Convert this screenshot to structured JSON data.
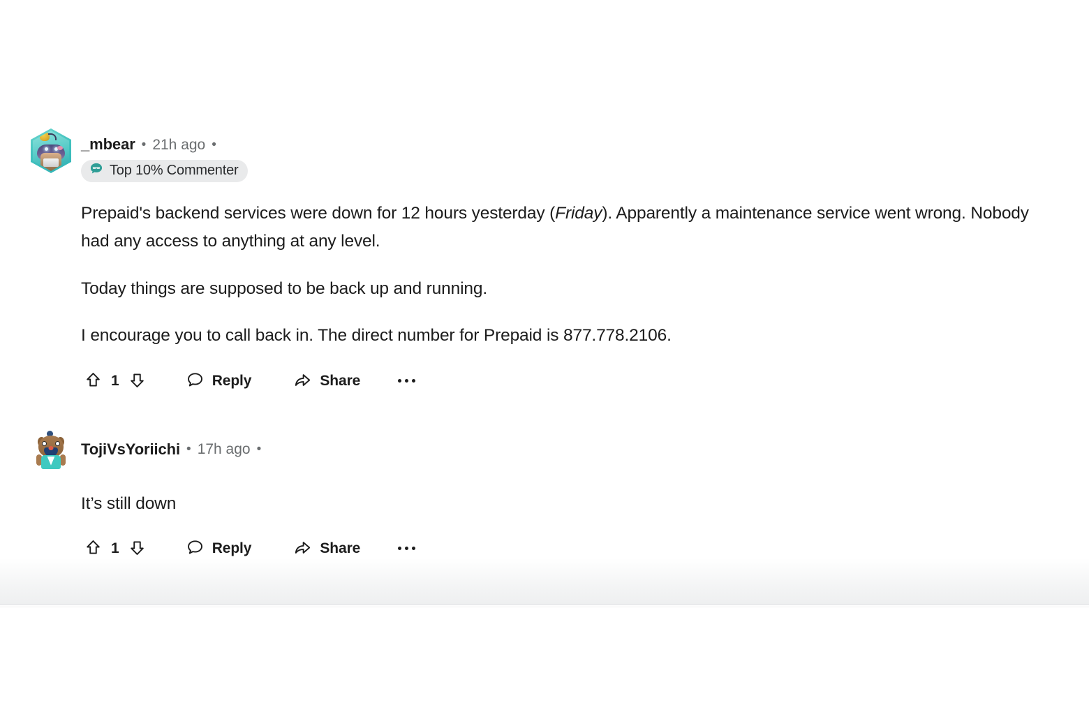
{
  "theme": {
    "background": "#ffffff",
    "text_primary": "#1c1c1c",
    "text_muted": "#6a6d6f",
    "badge_bg": "#e9eaeb",
    "badge_icon_color": "#2e9e96",
    "divider": "#e3e4e6"
  },
  "comments": [
    {
      "id": "comment-1",
      "username": "_mbear",
      "separator": "•",
      "timestamp": "21h ago",
      "trailing_separator": "•",
      "avatar_type": "hexagon-nft-avatar",
      "badge": {
        "icon": "sunglasses-speech-bubble-icon",
        "label": "Top 10% Commenter"
      },
      "paragraphs": [
        {
          "segments": [
            {
              "text": "Prepaid's backend services were down for 12 hours yesterday (",
              "italic": false
            },
            {
              "text": "Friday",
              "italic": true
            },
            {
              "text": "). Apparently a maintenance service went wrong. Nobody had any access to anything at any level.",
              "italic": false
            }
          ]
        },
        {
          "segments": [
            {
              "text": "Today things are supposed to be back up and running.",
              "italic": false
            }
          ]
        },
        {
          "segments": [
            {
              "text": "I encourage you to call back in. The direct number for Prepaid is 877.778.2106.",
              "italic": false
            }
          ]
        }
      ],
      "actions": {
        "upvote_icon": "upvote-arrow-icon",
        "vote_count": "1",
        "downvote_icon": "downvote-arrow-icon",
        "reply_icon": "comment-bubble-icon",
        "reply_label": "Reply",
        "share_icon": "share-arrow-icon",
        "share_label": "Share",
        "more_icon": "overflow-menu-icon"
      }
    },
    {
      "id": "comment-2",
      "username": "TojiVsYoriichi",
      "separator": "•",
      "timestamp": "17h ago",
      "trailing_separator": "•",
      "avatar_type": "round-snoo-avatar",
      "badge": null,
      "paragraphs": [
        {
          "segments": [
            {
              "text": "It’s still down",
              "italic": false
            }
          ]
        }
      ],
      "actions": {
        "upvote_icon": "upvote-arrow-icon",
        "vote_count": "1",
        "downvote_icon": "downvote-arrow-icon",
        "reply_icon": "comment-bubble-icon",
        "reply_label": "Reply",
        "share_icon": "share-arrow-icon",
        "share_label": "Share",
        "more_icon": "overflow-menu-icon"
      }
    }
  ]
}
